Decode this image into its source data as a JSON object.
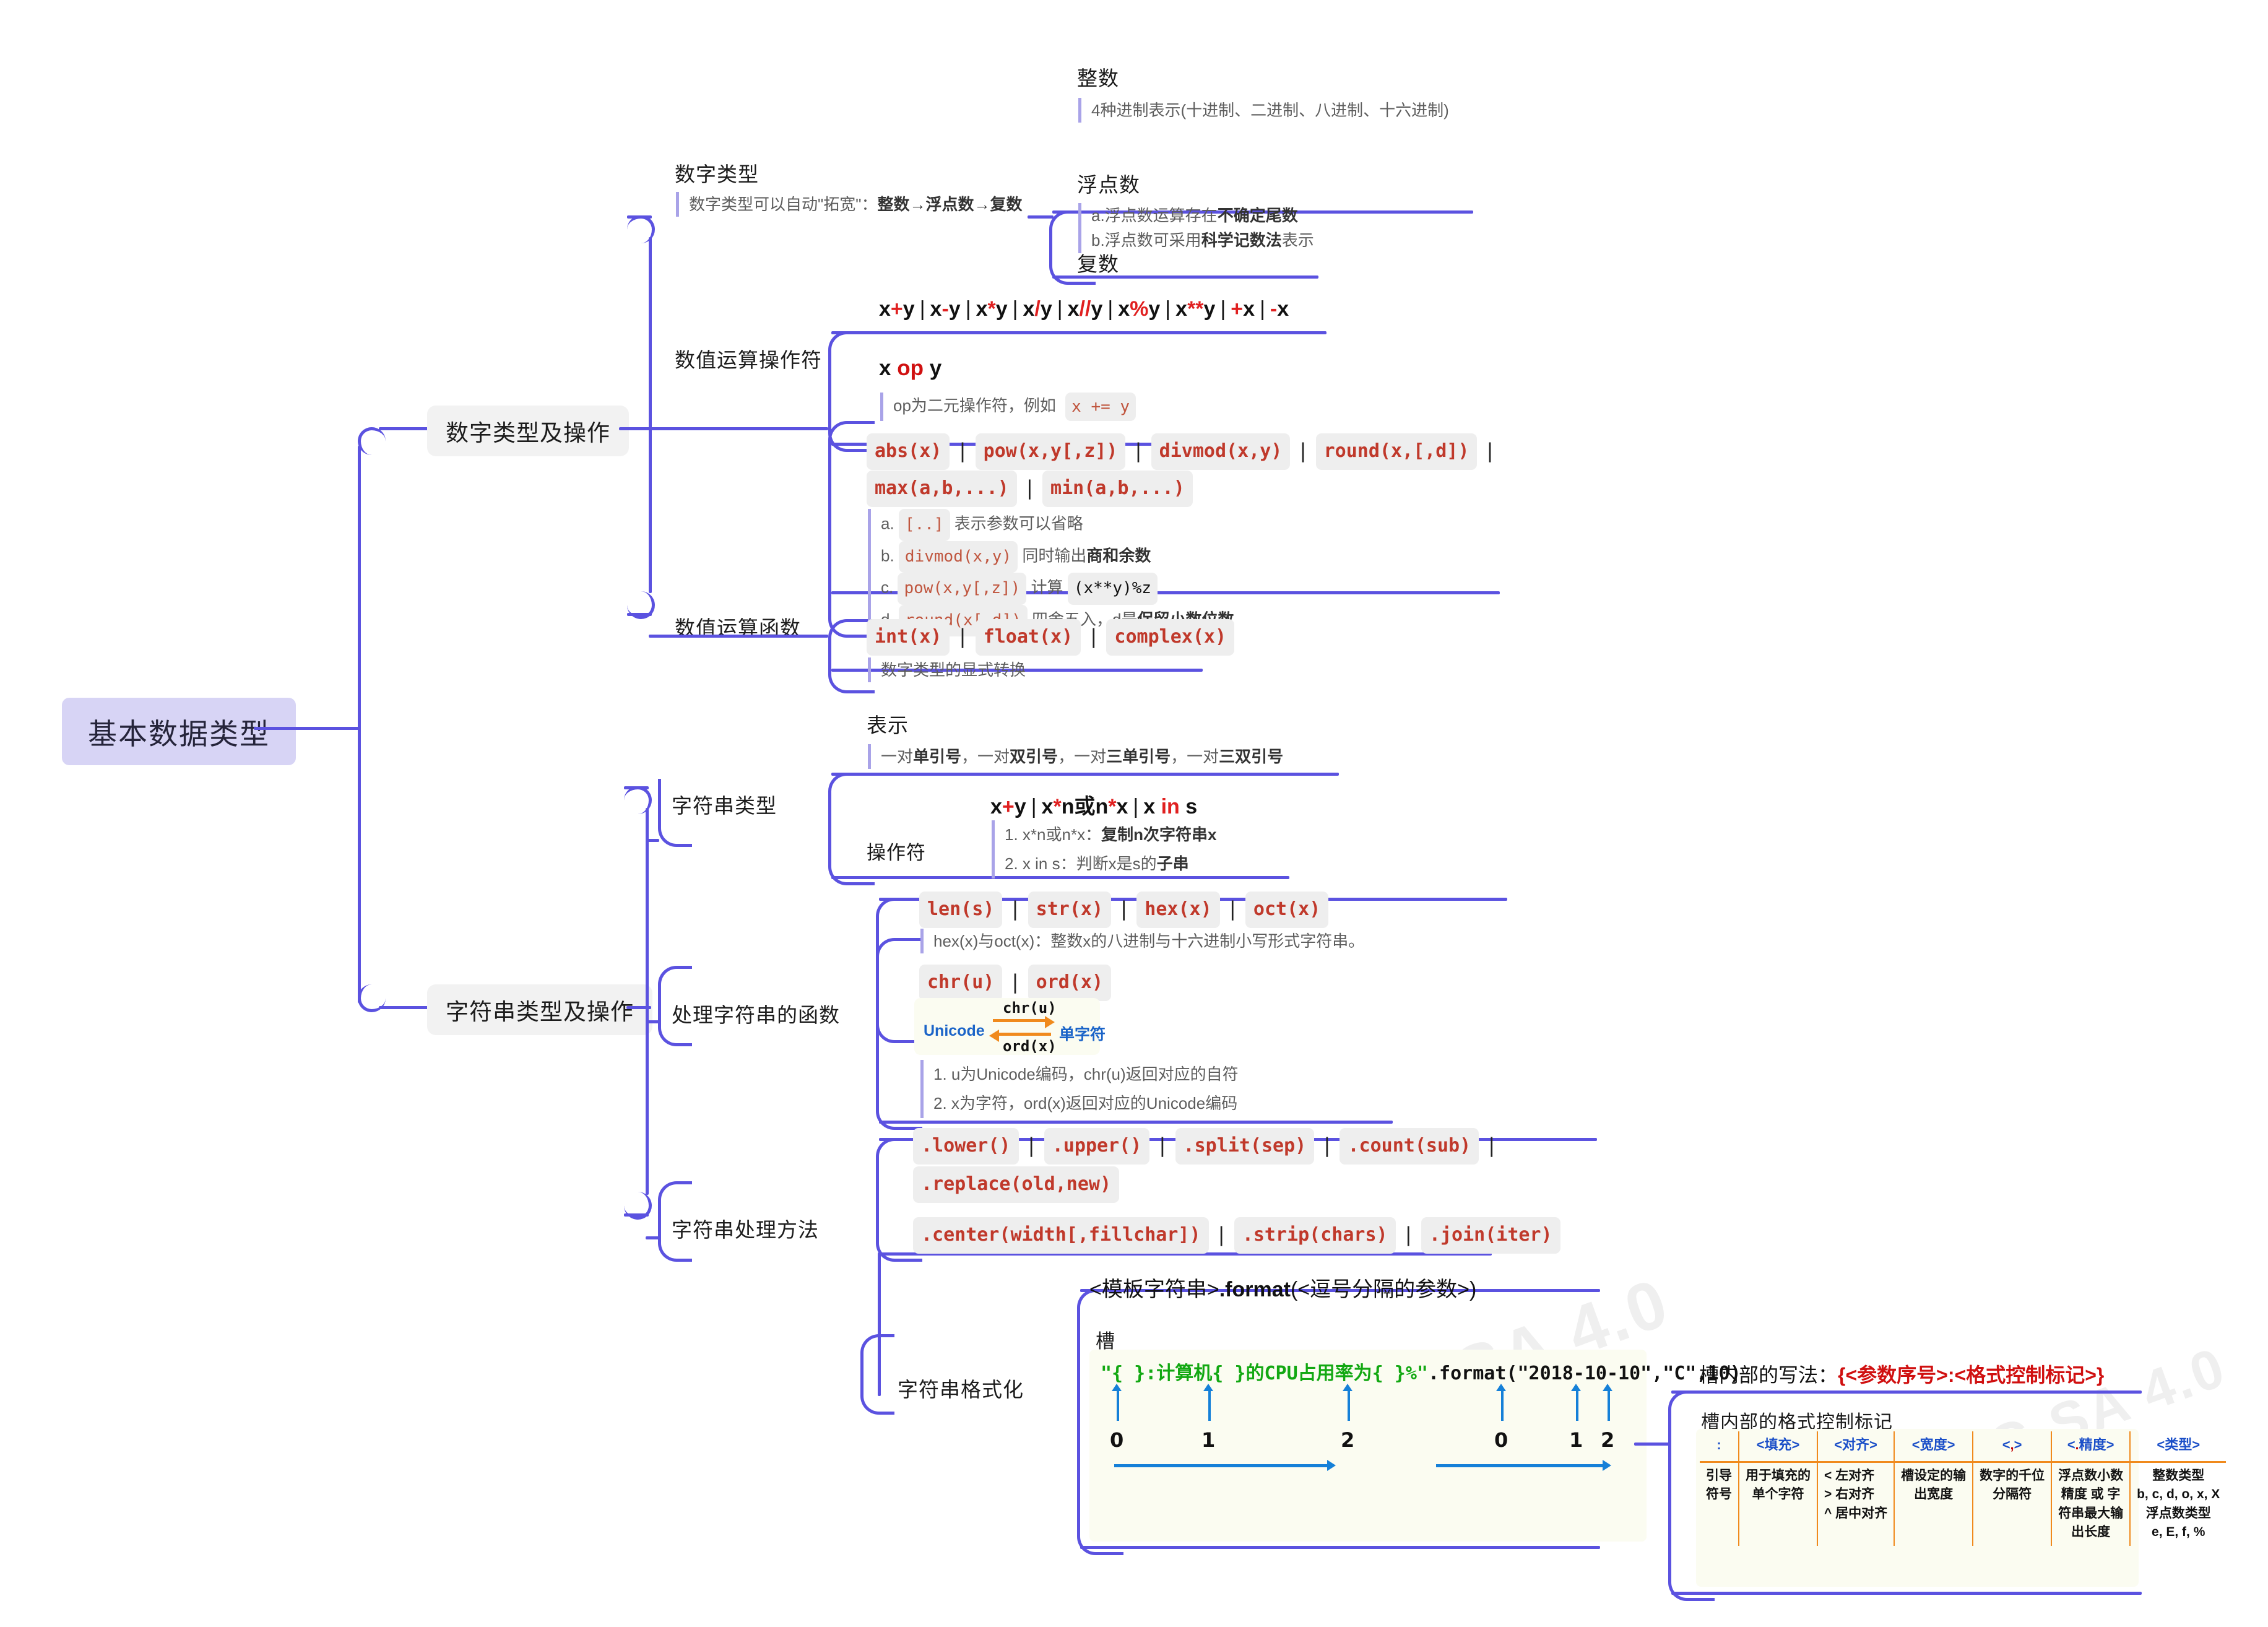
{
  "root": {
    "label": "基本数据类型"
  },
  "branches": [
    {
      "label": "数字类型及操作"
    },
    {
      "label": "字符串类型及操作"
    }
  ],
  "numbers": {
    "types": {
      "label": "数字类型",
      "note": "数字类型可以自动\"拓宽\"：整数→浮点数→复数",
      "note_plain": "数字类型可以自动\"拓宽\"：",
      "note_bold": "整数→浮点数→复数",
      "children": [
        {
          "label": "整数",
          "note": "4种进制表示(十进制、二进制、八进制、十六进制)"
        },
        {
          "label": "浮点数",
          "notes": [
            {
              "a": "a.浮点数运算存在",
              "b": "不确定尾数"
            },
            {
              "a": "b.浮点数可采用",
              "b": "科学记数法",
              "c": "表示"
            }
          ]
        },
        {
          "label": "复数"
        }
      ]
    },
    "operators": {
      "label": "数值运算操作符",
      "banner": [
        {
          "t": "x"
        },
        {
          "t": "+",
          "red": true
        },
        {
          "t": "y"
        },
        {
          "bar": true
        },
        {
          "t": "x"
        },
        {
          "t": "-",
          "red": true
        },
        {
          "t": "y"
        },
        {
          "bar": true
        },
        {
          "t": "x"
        },
        {
          "t": "*",
          "red": true
        },
        {
          "t": "y"
        },
        {
          "bar": true
        },
        {
          "t": "x"
        },
        {
          "t": "/",
          "red": true
        },
        {
          "t": "y"
        },
        {
          "bar": true
        },
        {
          "t": "x"
        },
        {
          "t": "//",
          "red": true
        },
        {
          "t": "y"
        },
        {
          "bar": true
        },
        {
          "t": "x"
        },
        {
          "t": "%",
          "red": true
        },
        {
          "t": "y"
        },
        {
          "bar": true
        },
        {
          "t": "x"
        },
        {
          "t": "**",
          "red": true
        },
        {
          "t": "y"
        },
        {
          "bar": true
        },
        {
          "t": "+",
          "red": true
        },
        {
          "t": "x"
        },
        {
          "bar": true
        },
        {
          "t": "-",
          "red": true
        },
        {
          "t": "x"
        }
      ],
      "banner_text": "x+y | x-y | x*y | x/y | x//y | x%y | x**y | +x | -x",
      "sub_label_a": "x ",
      "sub_label_op": "op",
      "sub_label_b": " y",
      "sub_note_pre": "op为二元操作符，例如",
      "sub_note_code": "x += y"
    },
    "functions": {
      "label": "数值运算函数",
      "row1": [
        "abs(x)",
        "pow(x,y[,z])",
        "divmod(x,y)",
        "round(x,[,d])"
      ],
      "row2": [
        "max(a,b,...)",
        "min(a,b,...)"
      ],
      "notes": [
        {
          "idx": "a.",
          "code": "[..]",
          "text": "表示参数可以省略"
        },
        {
          "idx": "b.",
          "code": "divmod(x,y)",
          "text": "同时输出",
          "bold": "商和余数"
        },
        {
          "idx": "c.",
          "code": "pow(x,y[,z])",
          "text": "计算",
          "code2": "(x**y)%z"
        },
        {
          "idx": "d.",
          "code": "round(x[,d])",
          "text": "四舍五入，d是",
          "bold": "保留小数位数"
        }
      ],
      "convert": [
        "int(x)",
        "float(x)",
        "complex(x)"
      ],
      "convert_note": "数字类型的显式转换"
    }
  },
  "strings": {
    "type": {
      "label": "字符串类型",
      "repr_label": "表示",
      "repr_note_parts": [
        "一对",
        "单引号",
        "，一对",
        "双引号",
        "，一对",
        "三单引号",
        "，一对",
        "三双引号"
      ],
      "repr_note": "一对单引号，一对双引号，一对三单引号，一对三双引号",
      "op_label": "操作符",
      "op_banner": "x+y | x*n或n*x | x in s",
      "op_notes": [
        {
          "a": "1. x*n或n*x：",
          "b": "复制n次字符串x"
        },
        {
          "a": "2. x in s：判断x是s的",
          "b": "子串"
        }
      ]
    },
    "funcs": {
      "label": "处理字符串的函数",
      "row1": [
        "len(s)",
        "str(x)",
        "hex(x)",
        "oct(x)"
      ],
      "row1_note": "hex(x)与oct(x)：整数x的八进制与十六进制小写形式字符串。",
      "row2": [
        "chr(u)",
        "ord(x)"
      ],
      "diagram": {
        "left": "Unicode",
        "right": "单字符",
        "top_fn": "chr(u)",
        "bottom_fn": "ord(x)"
      },
      "row2_notes": [
        "1. u为Unicode编码，chr(u)返回对应的自符",
        "2. x为字符，ord(x)返回对应的Unicode编码"
      ]
    },
    "methods": {
      "label": "字符串处理方法",
      "row1": [
        ".lower()",
        ".upper()",
        ".split(sep)",
        ".count(sub)"
      ],
      "row2": [
        ".replace(old,new)"
      ],
      "row3": [
        ".center(width[,fillchar])",
        ".strip(chars)",
        ".join(iter)"
      ]
    },
    "format": {
      "label": "字符串格式化",
      "title_a": "<模板字符串>",
      "title_b": ".format",
      "title_c": "(<逗号分隔的参数>)",
      "slot_label": "槽",
      "example_code": "\"{ }:计算机{ }的CPU占用率为{ }%\".format(\"2018-10-10\",\"C\",10)",
      "example_green": "\"{ }:计算机{ }的CPU占用率为{ }%\"",
      "example_black": ".format(\"2018-10-10\",\"C\",10)",
      "slot_indices_left": [
        "0",
        "1",
        "2"
      ],
      "slot_indices_right": [
        "0",
        "1",
        "2"
      ],
      "syntax_title_a": "槽内部的写法：",
      "syntax_title_b": "{<参数序号>:<格式控制标记>}",
      "table_title": "槽内部的格式控制标记",
      "table": {
        "headers": [
          ":",
          "<填充>",
          "<对齐>",
          "<宽度>",
          "<,>",
          "<.精度>",
          "<类型>"
        ],
        "cells": [
          [
            "引导",
            "符号"
          ],
          [
            "用于填充的",
            "单个字符"
          ],
          [
            "< 左对齐",
            "> 右对齐",
            "^ 居中对齐"
          ],
          [
            "槽设定的输",
            "出宽度"
          ],
          [
            "数字的千位",
            "分隔符"
          ],
          [
            "浮点数小数",
            "精度 或 字",
            "符串最大输",
            "出长度"
          ],
          [
            "整数类型",
            "b, c, d, o, x, X",
            "浮点数类型",
            "e, E, f, %"
          ]
        ]
      }
    }
  },
  "colors": {
    "branch_line": "#5b52e0",
    "root_bg": "#d7d4f5",
    "node_bg": "#f2f2f2",
    "code_red": "#c0392b",
    "accent_red": "#e02020",
    "blue": "#1b4fc8",
    "orange": "#f08a1d",
    "green": "#12a812"
  },
  "watermark": "CC BY-NC-SA 4.0"
}
